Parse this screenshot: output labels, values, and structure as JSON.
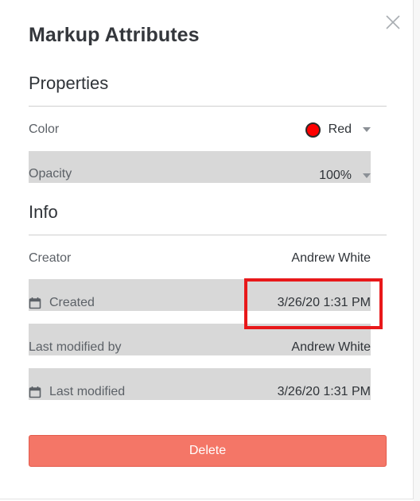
{
  "dialog": {
    "title": "Markup Attributes"
  },
  "properties": {
    "heading": "Properties",
    "color": {
      "label": "Color",
      "value": "Red",
      "swatch": "#ff0000",
      "icon": "chevron-down-icon"
    },
    "opacity": {
      "label": "Opacity",
      "value": "100%",
      "icon": "chevron-down-icon"
    }
  },
  "info": {
    "heading": "Info",
    "creator": {
      "label": "Creator",
      "value": "Andrew White"
    },
    "created": {
      "label": "Created",
      "value": "3/26/20 1:31 PM",
      "icon": "calendar-icon"
    },
    "last_modified_by": {
      "label": "Last modified by",
      "value": "Andrew White"
    },
    "last_modified": {
      "label": "Last modified",
      "value": "3/26/20 1:31 PM",
      "icon": "calendar-icon"
    }
  },
  "actions": {
    "delete_label": "Delete"
  },
  "colors": {
    "delete_bg": "#f47667",
    "highlight": "#e8181a",
    "text": "#2f3338",
    "muted": "#5c6167"
  }
}
